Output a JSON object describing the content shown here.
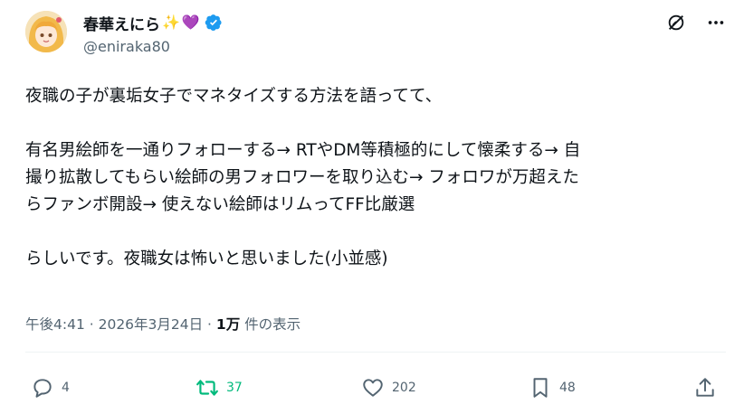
{
  "author": {
    "display_name": "春華えにら",
    "emoji_sparkles": "✨",
    "emoji_heart": "💜",
    "handle": "@eniraka80"
  },
  "tweet": {
    "line1": "夜職の子が裏垢女子でマネタイズする方法を語ってて、",
    "line2": "有名男絵師を一通りフォローする→ RTやDM等積極的にして懐柔する→ 自",
    "line3": "撮り拡散してもらい絵師の男フォロワーを取り込む→ フォロワが万超えた",
    "line4": "らファンボ開設→ 使えない絵師はリムってFF比厳選",
    "line5": "らしいです。夜職女は怖いと思いました(小並感)"
  },
  "meta": {
    "time": "午後4:41",
    "separator1": " · ",
    "date": "2026年3月24日",
    "separator2": " · ",
    "views_count": "1万",
    "views_label": " 件の表示"
  },
  "actions": {
    "replies": "4",
    "retweets": "37",
    "likes": "202",
    "bookmarks": "48"
  },
  "colors": {
    "retweet_green": "#00ba7c",
    "verified_blue": "#1d9bf0",
    "secondary_text": "#536471"
  },
  "icons": [
    "grok-icon",
    "more-icon",
    "reply-icon",
    "retweet-icon",
    "like-icon",
    "bookmark-icon",
    "share-icon",
    "verified-badge-icon"
  ]
}
